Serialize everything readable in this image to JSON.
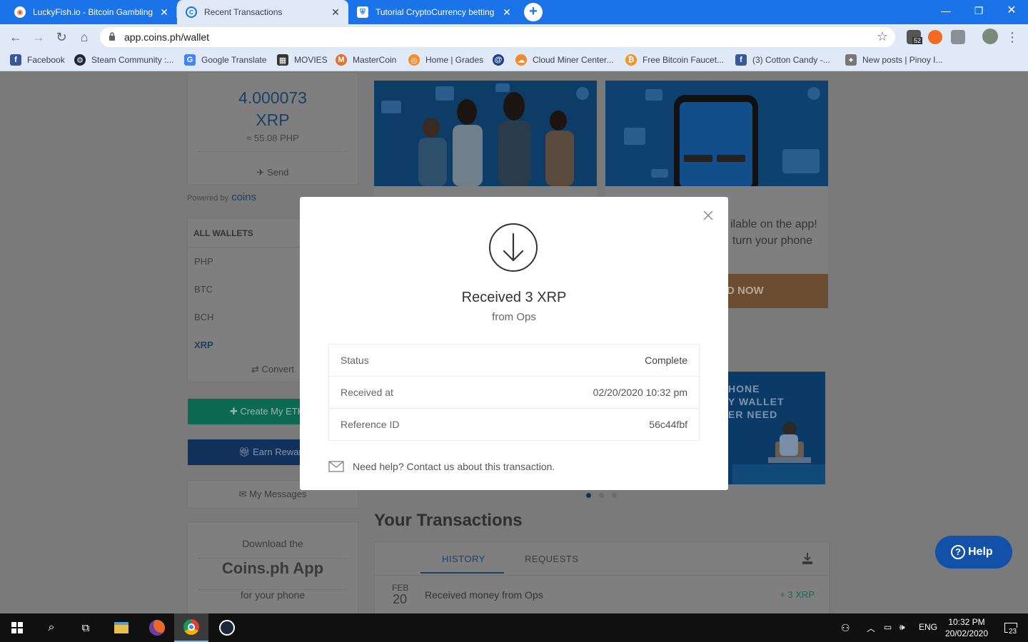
{
  "browser": {
    "tabs": [
      {
        "title": "LuckyFish.io - Bitcoin Gambling S",
        "icon": "luckyfish-icon",
        "active": false
      },
      {
        "title": "Recent Transactions",
        "icon": "coins-icon",
        "active": true
      },
      {
        "title": "Tutorial CryptoCurrency betting :",
        "icon": "shield-icon",
        "active": false
      }
    ],
    "url": "app.coins.ph/wallet",
    "bookmarks": [
      {
        "label": "Facebook",
        "icon": "facebook-icon",
        "color": "#3b5998"
      },
      {
        "label": "Steam Community :...",
        "icon": "steam-icon",
        "color": "#1b2838"
      },
      {
        "label": "Google Translate",
        "icon": "translate-icon",
        "color": "#4285f4"
      },
      {
        "label": "MOVIES",
        "icon": "film-icon",
        "color": "#333333"
      },
      {
        "label": "MasterCoin",
        "icon": "mastercoin-icon",
        "color": "#e0722b"
      },
      {
        "label": "Home | Grades",
        "icon": "grades-icon",
        "color": "#f58b2a"
      },
      {
        "label": "",
        "icon": "swirl-icon",
        "color": "#1d3f8f"
      },
      {
        "label": "Cloud Miner Center...",
        "icon": "cloud-icon",
        "color": "#f28a2e"
      },
      {
        "label": "Free Bitcoin Faucet...",
        "icon": "bitcoin-icon",
        "color": "#f7931a"
      },
      {
        "label": "(3) Cotton Candy -...",
        "icon": "facebook-icon",
        "color": "#3b5998"
      },
      {
        "label": "New posts | Pinoy I...",
        "icon": "pinoy-icon",
        "color": "#777777"
      }
    ],
    "extension_badge": "52"
  },
  "sidebar": {
    "balance_amount": "4.000073",
    "balance_currency": "XRP",
    "balance_php": "≈ 55.08 PHP",
    "send_label": "Send",
    "powered_by": "Powered by",
    "powered_brand": "coins",
    "wallets_heading": "ALL WALLETS",
    "wallets": [
      "PHP",
      "BTC",
      "BCH",
      "XRP"
    ],
    "convert_label": "Convert",
    "create_eth_label": "Create My ETH W",
    "earn_label": "Earn Reward",
    "messages_label": "My Messages",
    "download_line1": "Download the",
    "download_line2": "Coins.ph App",
    "download_line3": "for your phone"
  },
  "promos": {
    "promo2_line1": "ilable on the app!",
    "promo2_line2": "turn your phone",
    "promo2_button": "D NOW",
    "banner3_lines": [
      "HONE",
      "Y WALLET",
      "ER NEED"
    ]
  },
  "transactions": {
    "title": "Your Transactions",
    "tabs": [
      "HISTORY",
      "REQUESTS"
    ],
    "rows": [
      {
        "month": "FEB",
        "day": "20",
        "description": "Received money from Ops",
        "amount": "+ 3 XRP"
      }
    ]
  },
  "help_button": "Help",
  "modal": {
    "title": "Received 3 XRP",
    "subtitle": "from Ops",
    "rows": [
      {
        "key": "Status",
        "value": "Complete"
      },
      {
        "key": "Received at",
        "value": "02/20/2020 10:32 pm"
      },
      {
        "key": "Reference ID",
        "value": "56c44fbf"
      }
    ],
    "help_text": "Need help? Contact us about this transaction."
  },
  "taskbar": {
    "language": "ENG",
    "time": "10:32 PM",
    "date": "20/02/2020",
    "notification_count": "23"
  },
  "colors": {
    "chrome_blue": "#1a73e8",
    "brand_navy": "#1d3f63",
    "modal_bg": "#ffffff",
    "help_blue": "#1351a9"
  }
}
